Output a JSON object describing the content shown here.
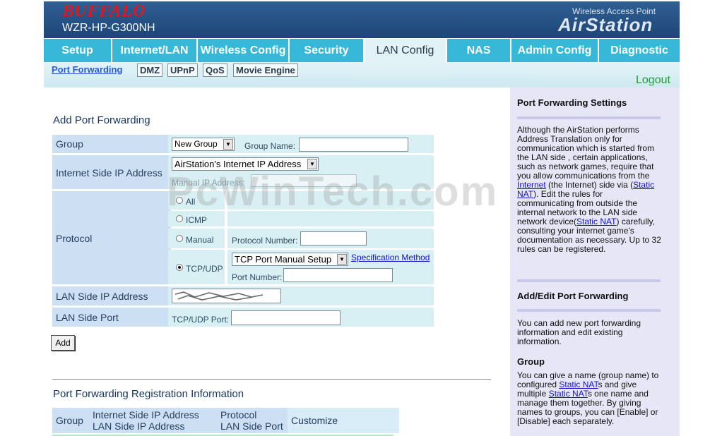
{
  "brand": {
    "logo": "BUFFALO",
    "model": "WZR-HP-G300NH",
    "tagline": "Wireless Access Point",
    "product": "AirStation"
  },
  "tabs": [
    "Setup",
    "Internet/LAN",
    "Wireless Config",
    "Security",
    "LAN Config",
    "NAS",
    "Admin Config",
    "Diagnostic"
  ],
  "active_tab": "LAN Config",
  "subnav": [
    "Port Forwarding",
    "DMZ",
    "UPnP",
    "QoS",
    "Movie Engine"
  ],
  "logout": "Logout",
  "add_section": {
    "title": "Add Port Forwarding",
    "group_label": "Group",
    "group_select": "New Group",
    "group_name_label": "Group Name:",
    "group_name_value": "",
    "internet_ip_label": "Internet Side IP Address",
    "internet_ip_select": "AirStation's Internet IP Address",
    "manual_ip_label": "Manual IP Address:",
    "protocol_label": "Protocol",
    "protocol_all": "All",
    "protocol_icmp": "ICMP",
    "protocol_manual": "Manual",
    "protocol_number_label": "Protocol Number:",
    "protocol_tcpudp": "TCP/UDP",
    "tcp_select": "TCP Port Manual Setup",
    "spec_link": "Specification Method",
    "port_number_label": "Port Number:",
    "lan_ip_label": "LAN Side IP Address",
    "lan_port_label": "LAN Side Port",
    "tcpudp_port_label": "TCP/UDP Port:",
    "add_button": "Add"
  },
  "registration": {
    "title": "Port Forwarding Registration Information",
    "col_group": "Group",
    "col_ip_1": "Internet Side IP Address",
    "col_ip_2": "LAN Side IP Address",
    "col_proto_1": "Protocol",
    "col_proto_2": "LAN Side Port",
    "col_customize": "Customize"
  },
  "help": {
    "title1": "Port Forwarding Settings",
    "p1_a": "Although the AirStation performs Address Translation only for communication which is started from the LAN side , certain applications, such as network games, require that you allow communications from the ",
    "p1_link1": "Internet",
    "p1_b": " (the Internet) side via (",
    "p1_link2": "Static NAT",
    "p1_c": "). Edit the rules for communicating from outside the internal network to the LAN side network device(",
    "p1_link3": "Static NAT",
    "p1_d": ") carefully, consulting your internet game's documentation as necessary. Up to 32 rules can be registered.",
    "title2": "Add/Edit Port Forwarding",
    "p2": "You can add new port forwarding information and edit existing information.",
    "title3": "Group",
    "p3_a": "You can give a name (group name) to configured ",
    "p3_link1": "Static NAT",
    "p3_b": "s and give multiple ",
    "p3_link2": "Static NAT",
    "p3_c": "s one name and manage them together. By giving names to groups, you can [Enable] or [Disable] each separately."
  },
  "watermark": "PcWinTech.com"
}
